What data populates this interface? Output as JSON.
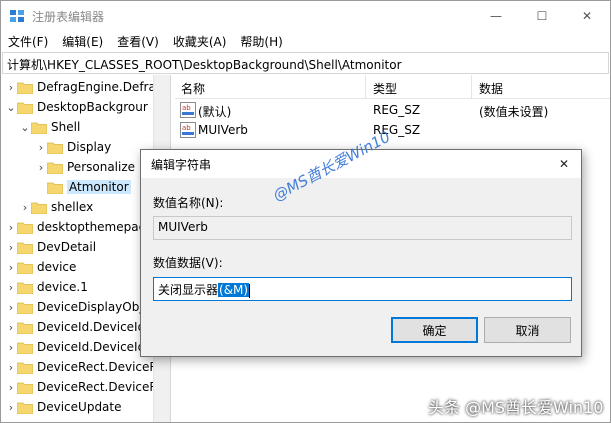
{
  "window": {
    "title": "注册表编辑器",
    "minimize_glyph": "—",
    "maximize_glyph": "☐",
    "close_glyph": "✕"
  },
  "menu": [
    "文件(F)",
    "编辑(E)",
    "查看(V)",
    "收藏夹(A)",
    "帮助(H)"
  ],
  "address": "计算机\\HKEY_CLASSES_ROOT\\DesktopBackground\\Shell\\Atmonitor",
  "tree": {
    "items": [
      {
        "label": "DefragEngine.Defra",
        "chevron": "›"
      },
      {
        "label": "DesktopBackgrour",
        "chevron": "⌄"
      },
      {
        "label": "Shell",
        "chevron": "⌄"
      },
      {
        "label": "Display",
        "chevron": "›"
      },
      {
        "label": "Personalize",
        "chevron": "›"
      },
      {
        "label": "Atmonitor",
        "chevron": ""
      },
      {
        "label": "shellex",
        "chevron": "›"
      },
      {
        "label": "desktopthemepac",
        "chevron": "›"
      },
      {
        "label": "DevDetail",
        "chevron": "›"
      },
      {
        "label": "device",
        "chevron": "›"
      },
      {
        "label": "device.1",
        "chevron": "›"
      },
      {
        "label": "DeviceDisplayObj",
        "chevron": "›"
      },
      {
        "label": "DeviceId.DeviceId",
        "chevron": "›"
      },
      {
        "label": "DeviceId.DeviceId",
        "chevron": "›"
      },
      {
        "label": "DeviceRect.DeviceR",
        "chevron": "›"
      },
      {
        "label": "DeviceRect.DeviceR",
        "chevron": "›"
      },
      {
        "label": "DeviceUpdate",
        "chevron": "›"
      }
    ]
  },
  "list": {
    "headers": {
      "name": "名称",
      "type": "类型",
      "data": "数据"
    },
    "rows": [
      {
        "name": "(默认)",
        "type": "REG_SZ",
        "data": "(数值未设置)",
        "icon": "ab-string-icon"
      },
      {
        "name": "MUIVerb",
        "type": "REG_SZ",
        "data": "",
        "icon": "ab-string-icon"
      }
    ]
  },
  "dialog": {
    "title": "编辑字符串",
    "close_glyph": "✕",
    "name_label": "数值名称(N):",
    "name_value": "MUIVerb",
    "data_label": "数值数据(V):",
    "data_value_plain": "关闭显示器",
    "data_value_selected": "(&M)",
    "ok_label": "确定",
    "cancel_label": "取消"
  },
  "watermarks": {
    "center": "@MS酋长爱Win10",
    "footer": "头条 @MS酋长爱Win10"
  },
  "colors": {
    "accent": "#0078d7",
    "folder": "#f5d76e",
    "selection": "#cce8ff"
  }
}
